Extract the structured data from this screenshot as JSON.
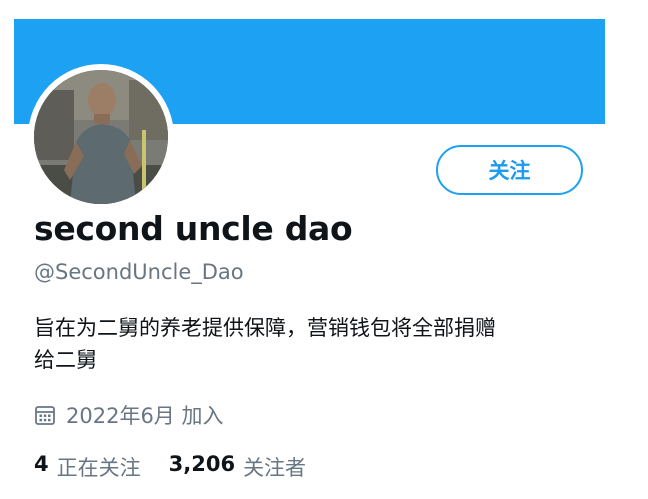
{
  "profile": {
    "display_name": "second uncle dao",
    "handle": "@SecondUncle_Dao",
    "bio_line1": "旨在为二舅的养老提供保障，营销钱包将全部捐赠",
    "bio_line2": "给二舅",
    "joined": "2022年6月 加入",
    "joined_icon": "calendar-icon",
    "follow_label": "关注"
  },
  "stats": {
    "following_count": "4",
    "following_label": "正在关注",
    "followers_count": "3,206",
    "followers_label": "关注者"
  },
  "colors": {
    "banner": "#1da1f2",
    "accent": "#1d9bf0",
    "secondary_text": "#687684",
    "primary_text": "#0f1419"
  }
}
